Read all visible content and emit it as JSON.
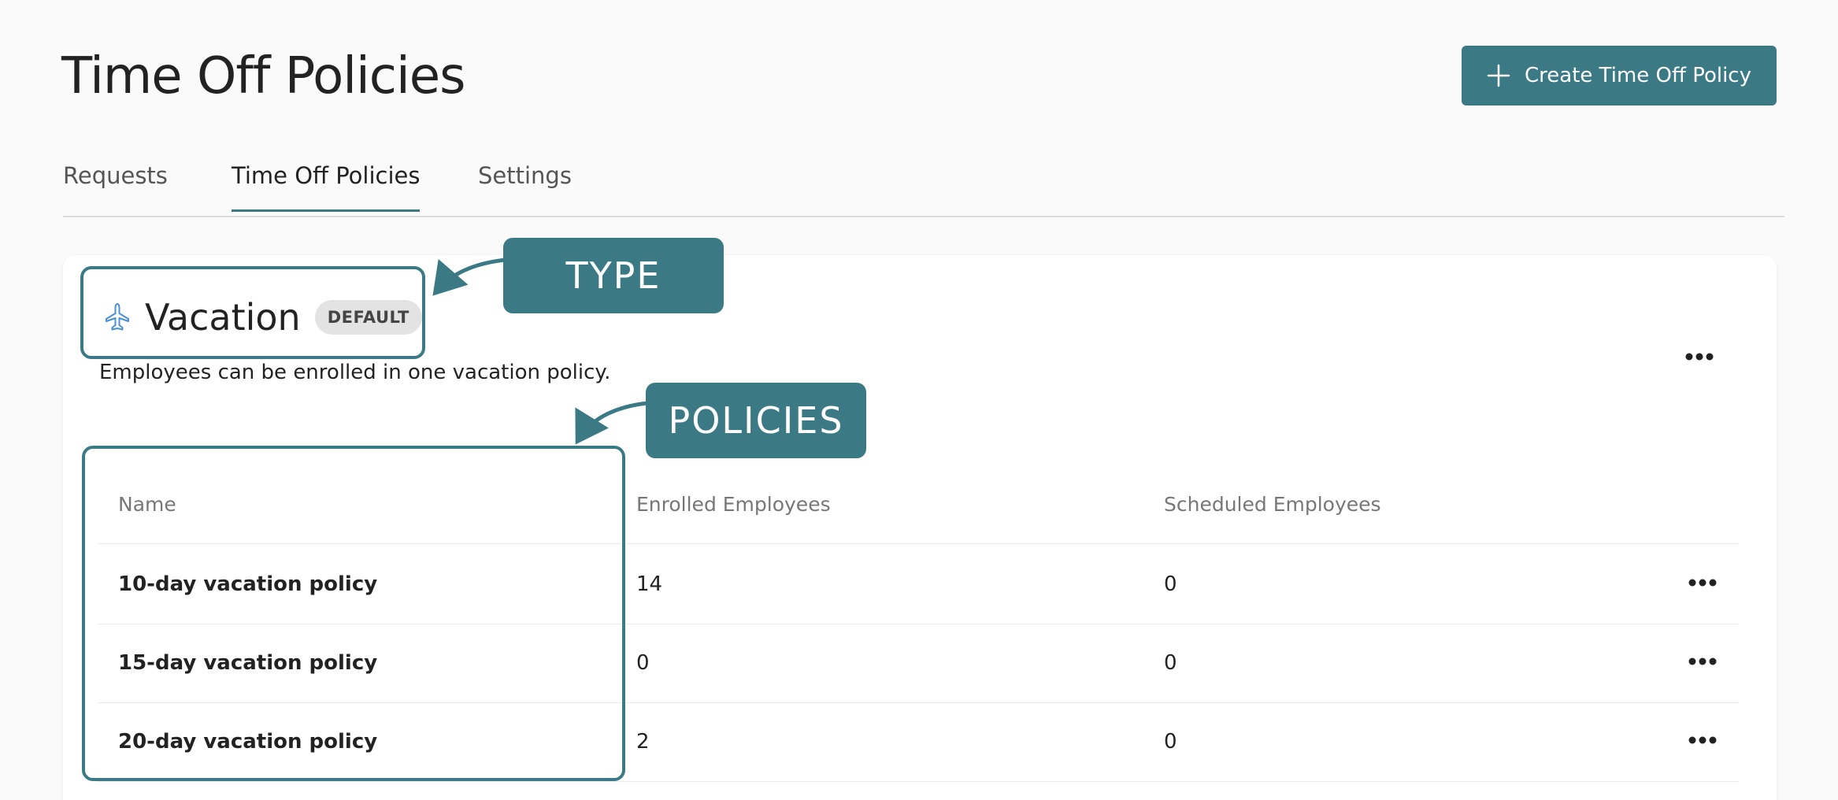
{
  "header": {
    "title": "Time Off Policies",
    "create_button_label": "Create Time Off Policy"
  },
  "tabs": [
    {
      "label": "Requests",
      "active": false
    },
    {
      "label": "Time Off Policies",
      "active": true
    },
    {
      "label": "Settings",
      "active": false
    }
  ],
  "policy_type": {
    "title": "Vacation",
    "badge": "DEFAULT",
    "description": "Employees can be enrolled in one vacation policy.",
    "icon": "airplane-icon"
  },
  "table": {
    "columns": [
      "Name",
      "Enrolled Employees",
      "Scheduled Employees"
    ],
    "rows": [
      {
        "name": "10-day vacation policy",
        "enrolled": "14",
        "scheduled": "0"
      },
      {
        "name": "15-day vacation policy",
        "enrolled": "0",
        "scheduled": "0"
      },
      {
        "name": "20-day vacation policy",
        "enrolled": "2",
        "scheduled": "0"
      }
    ]
  },
  "annotations": {
    "type_label": "TYPE",
    "policies_label": "POLICIES"
  },
  "colors": {
    "accent": "#3b7a85",
    "icon_blue": "#4a8fd6"
  }
}
